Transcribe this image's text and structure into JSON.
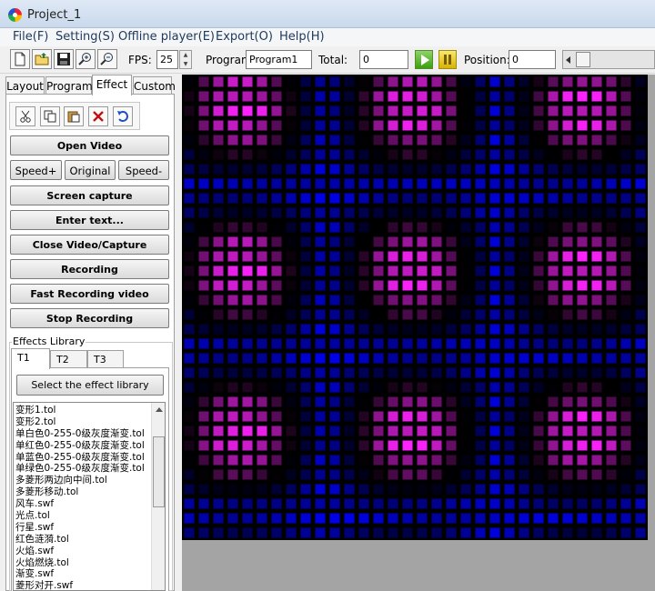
{
  "window": {
    "title": "Project_1"
  },
  "menu": [
    "File(F)",
    "Setting(S)",
    "Offline player(E)",
    "Export(O)",
    "Help(H)"
  ],
  "toolbar": {
    "icons": [
      "new-file-icon",
      "open-folder-icon",
      "save-icon",
      "zoom-in-icon",
      "zoom-out-icon"
    ],
    "fps_label": "FPS:",
    "fps_value": "25",
    "program_label": "Program:",
    "program_value": "Program1",
    "total_label": "Total:",
    "total_value": "0",
    "position_label": "Position:",
    "position_value": "0"
  },
  "tabs": [
    {
      "label": "Layout"
    },
    {
      "label": "Program"
    },
    {
      "label": "Effect",
      "active": true
    },
    {
      "label": "Custom"
    }
  ],
  "edit_tools": [
    "cut-icon",
    "copy-icon",
    "paste-icon",
    "delete-icon",
    "undo-icon"
  ],
  "buttons": {
    "open_video": "Open Video",
    "speed_up": "Speed+",
    "original": "Original",
    "speed_down": "Speed-",
    "screen_capture": "Screen capture",
    "enter_text": "Enter text...",
    "close_video": "Close Video/Capture",
    "recording": "Recording",
    "fast_recording": "Fast Recording video",
    "stop_recording": "Stop Recording"
  },
  "effects_library": {
    "title": "Effects Library",
    "tabs": [
      "T1",
      "T2",
      "T3"
    ],
    "active_tab": "T1",
    "select_button": "Select the effect library",
    "files": [
      "变形1.tol",
      "变形2.tol",
      "单白色0-255-0级灰度渐变.tol",
      "单红色0-255-0级灰度渐变.tol",
      "单蓝色0-255-0级灰度渐变.tol",
      "单绿色0-255-0级灰度渐变.tol",
      "多菱形两边向中间.tol",
      "多菱形移动.tol",
      "风车.swf",
      "光点.tol",
      "行星.swf",
      "红色涟漪.tol",
      "火焰.swf",
      "火焰燃烧.tol",
      "渐变.swf",
      "菱形对开.swf"
    ]
  },
  "canvas": {
    "background_color": "#a4a4a4",
    "led_grid_cols": 32,
    "led_grid_rows": 32,
    "colors": {
      "blue": "#1a1aff",
      "magenta": "#ff22ff",
      "dark": "#000000"
    }
  }
}
